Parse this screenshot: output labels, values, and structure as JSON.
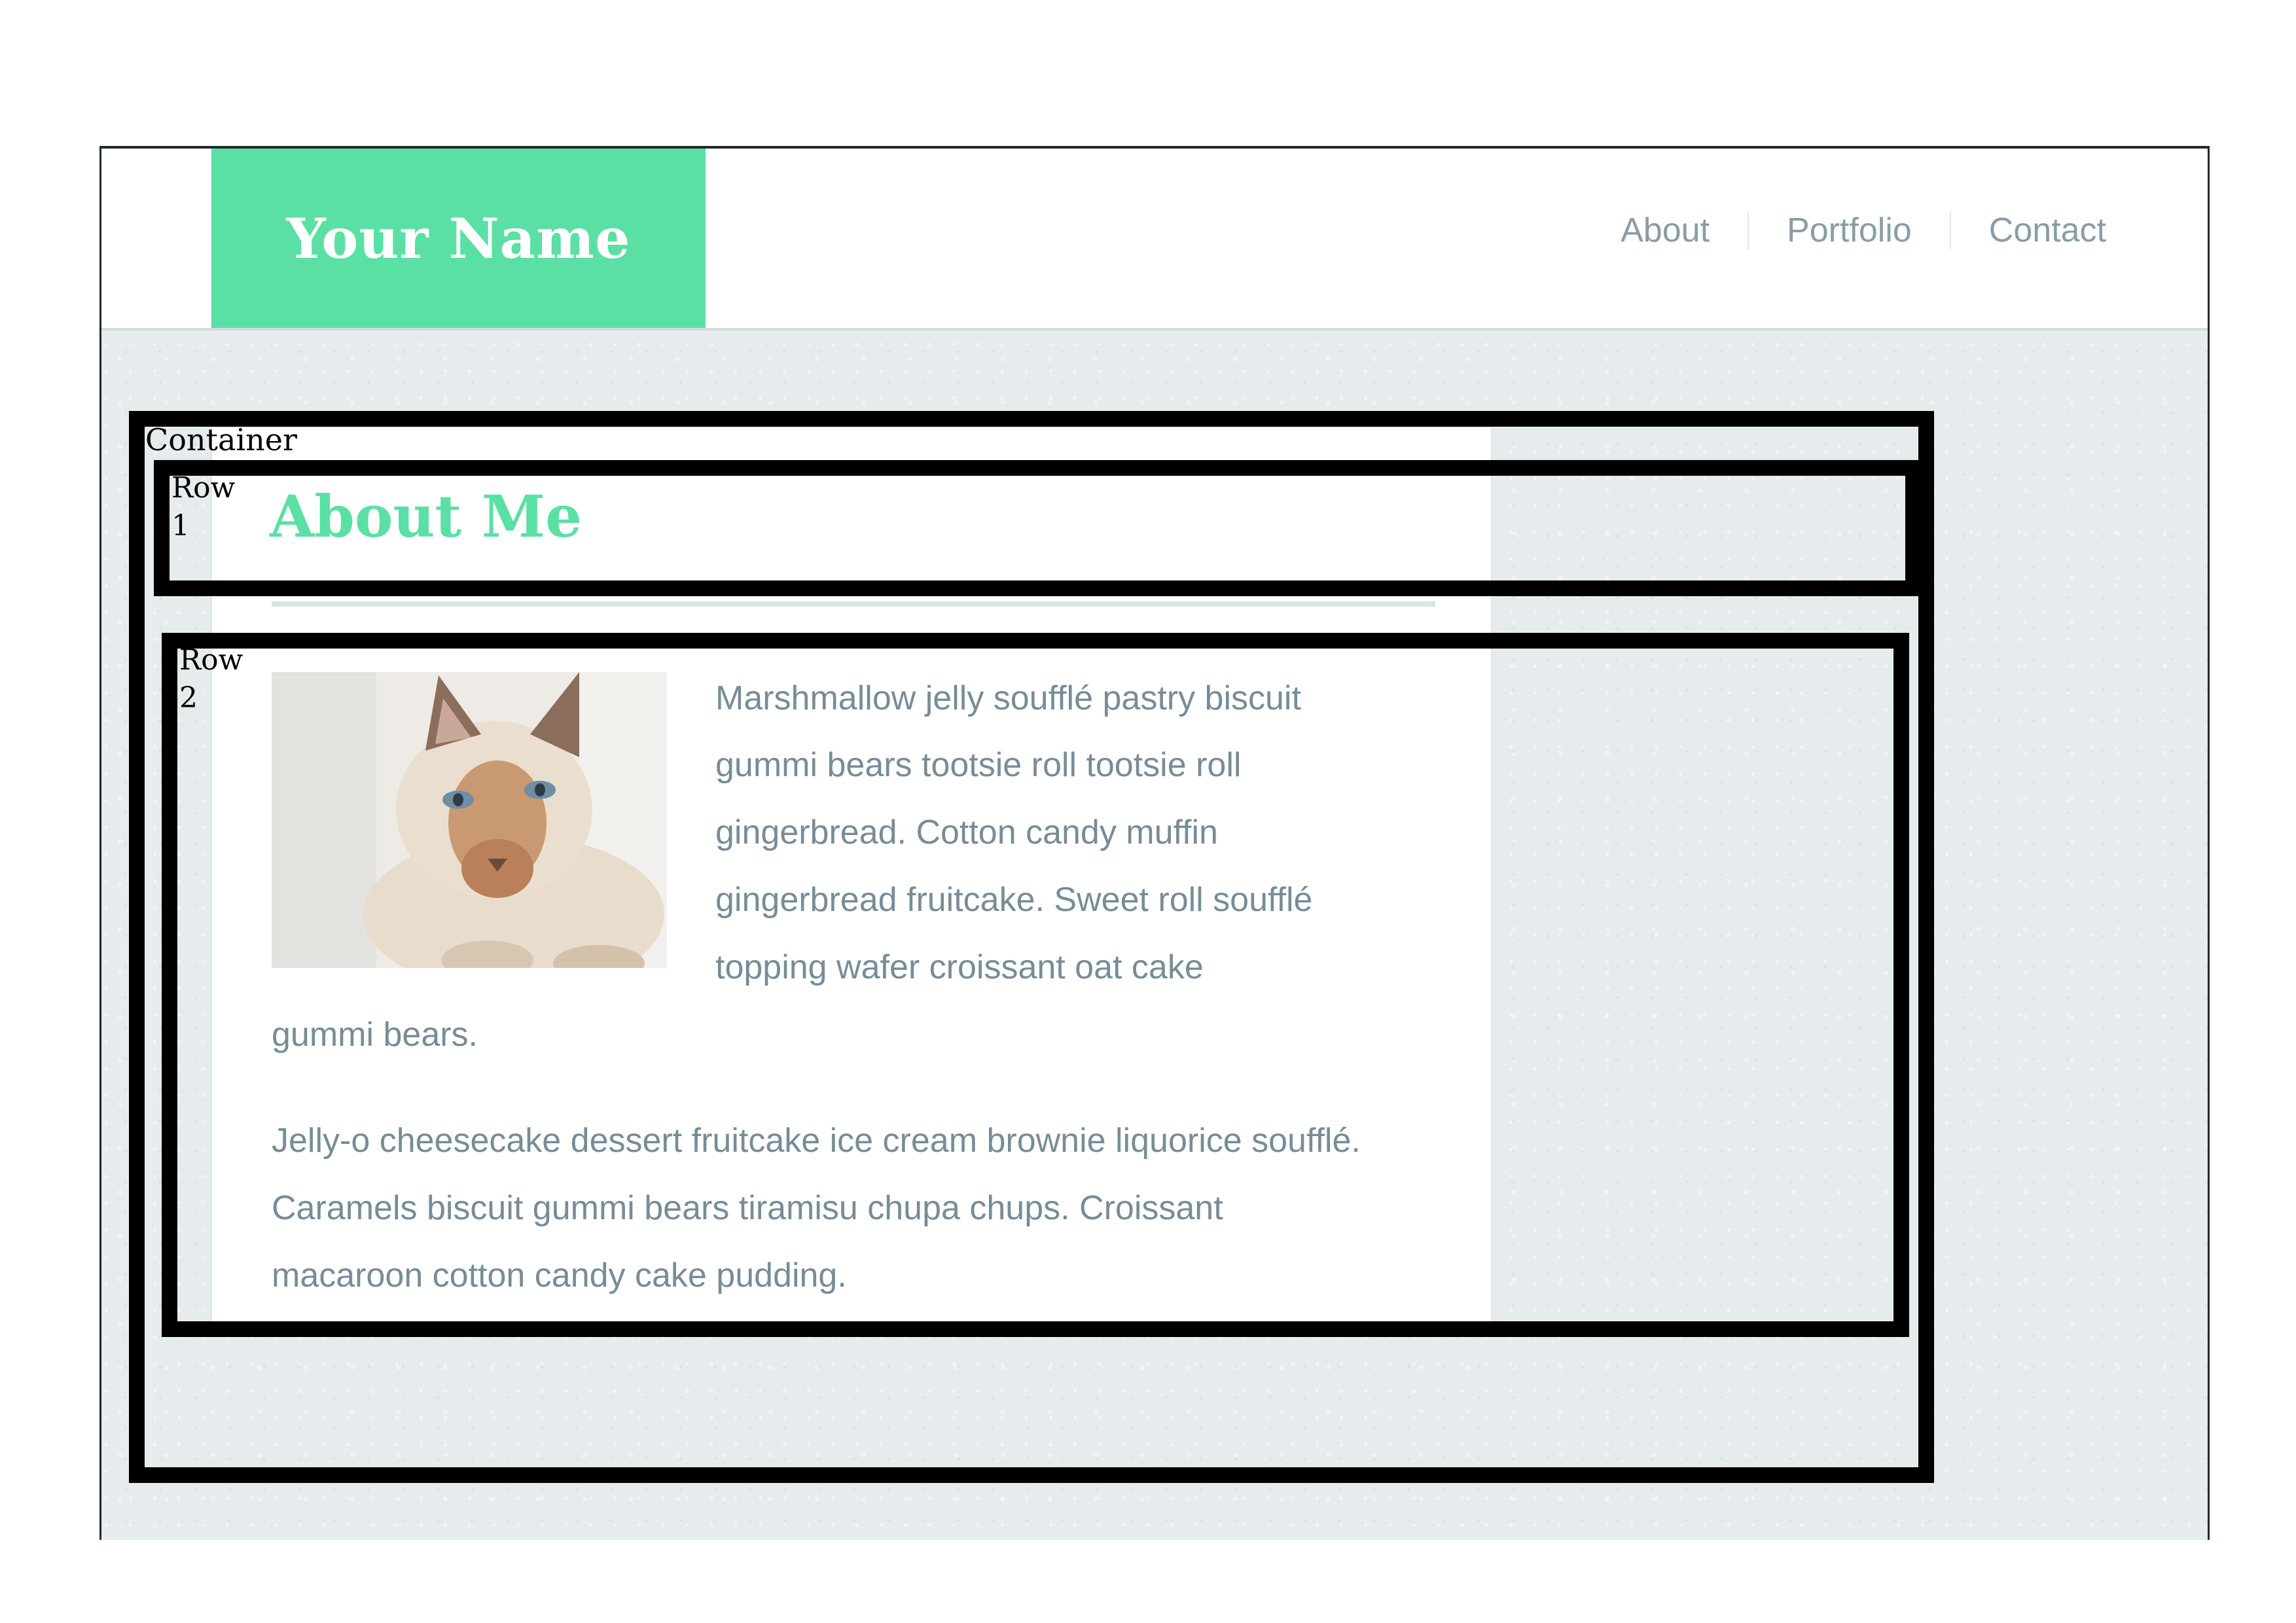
{
  "header": {
    "brand": "Your Name",
    "nav": [
      {
        "label": "About"
      },
      {
        "label": "Portfolio"
      },
      {
        "label": "Contact"
      }
    ]
  },
  "annotations": {
    "container_label": "Container",
    "row1_label": "Row 1",
    "row2_label": "Row 2"
  },
  "main": {
    "heading": "About Me",
    "paragraph1_lines": [
      "Marshmallow jelly soufflé pastry biscuit",
      "gummi bears tootsie roll tootsie roll",
      "gingerbread. Cotton candy muffin",
      "gingerbread fruitcake. Sweet roll soufflé",
      "topping wafer croissant oat cake",
      "gummi bears."
    ],
    "paragraph2_lines": [
      "Jelly-o cheesecake dessert fruitcake ice cream brownie liquorice soufflé.",
      "Caramels biscuit gummi bears tiramisu chupa chups. Croissant",
      "macaroon cotton candy cake pudding."
    ]
  },
  "colors": {
    "brand_green": "#5ae0a4",
    "nav_text": "#8a9ca6",
    "body_text": "#778c97",
    "page_background": "#e6ecee"
  },
  "icons": {
    "photo": "cat-photo"
  }
}
